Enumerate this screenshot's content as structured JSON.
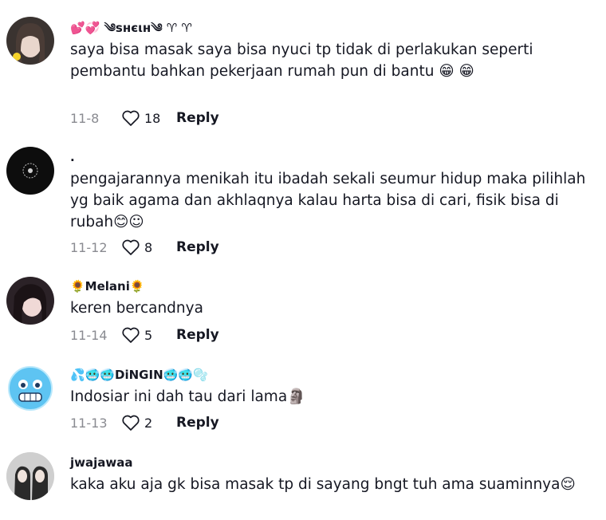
{
  "comments": [
    {
      "username": "💕💞 ༄sнєιн༄ ♈ ♈",
      "text": "saya bisa masak saya bisa nyuci tp tidak di perlakukan seperti pembantu bahkan pekerjaan rumah pun di bantu 😁 😁",
      "date": "11-8",
      "likes": "18",
      "reply": "Reply"
    },
    {
      "username": ".",
      "text": "pengajarannya menikah itu ibadah sekali seumur hidup maka pilihlah yg baik agama dan akhlaqnya kalau harta bisa di cari, fisik bisa di rubah😊☺",
      "date": "11-12",
      "likes": "8",
      "reply": "Reply"
    },
    {
      "username": "🌻Melani🌻",
      "text": "keren bercandnya",
      "date": "11-14",
      "likes": "5",
      "reply": "Reply"
    },
    {
      "username": "💦🥶🥶DiNGIN🥶🥶🫧",
      "text": "Indosiar ini dah tau dari lama🗿",
      "date": "11-13",
      "likes": "2",
      "reply": "Reply"
    },
    {
      "username": "jwajawaa",
      "text": "kaka aku aja gk bisa masak tp di sayang bngt tuh ama suaminnya😌",
      "reply": "Reply"
    }
  ]
}
